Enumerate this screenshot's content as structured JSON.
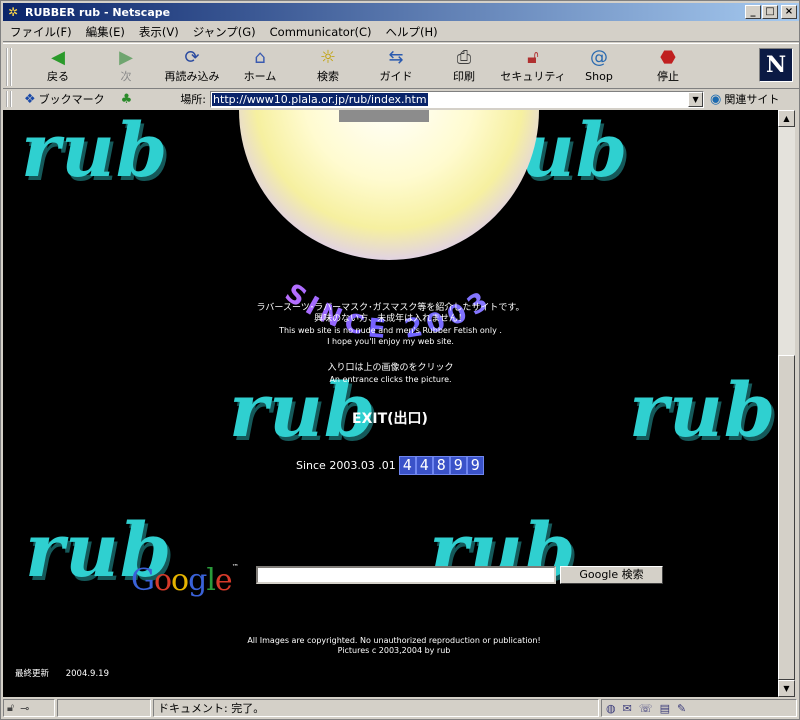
{
  "window": {
    "title": "RUBBER rub - Netscape",
    "app_icon": "netscape-icon",
    "controls": [
      "_",
      "□",
      "×"
    ]
  },
  "menu": [
    "ファイル(F)",
    "編集(E)",
    "表示(V)",
    "ジャンプ(G)",
    "Communicator(C)",
    "ヘルプ(H)"
  ],
  "toolbar": {
    "buttons": [
      {
        "label": "戻る",
        "icon": "back-arrow-icon",
        "enabled": true
      },
      {
        "label": "次",
        "icon": "forward-arrow-icon",
        "enabled": false
      },
      {
        "label": "再読み込み",
        "icon": "reload-icon",
        "enabled": true
      },
      {
        "label": "ホーム",
        "icon": "home-icon",
        "enabled": true
      },
      {
        "label": "検索",
        "icon": "search-icon",
        "enabled": true
      },
      {
        "label": "ガイド",
        "icon": "guide-icon",
        "enabled": true
      },
      {
        "label": "印刷",
        "icon": "print-icon",
        "enabled": true
      },
      {
        "label": "セキュリティ",
        "icon": "security-lock-icon",
        "enabled": true
      },
      {
        "label": "Shop",
        "icon": "shop-icon",
        "enabled": true
      },
      {
        "label": "停止",
        "icon": "stop-icon",
        "enabled": true
      }
    ],
    "logo": "N"
  },
  "location_bar": {
    "bookmarks_label": "ブックマーク",
    "location_label": "場所:",
    "url": "http://www10.plala.or.jp/rub/index.htm",
    "related_label": "関連サイト"
  },
  "page": {
    "logo_word": "rub",
    "badge_text": "SINCE 2003",
    "intro_jp_1": "ラバースーツ･ラバーマスク･ガスマスク等を紹介したサイトです。",
    "intro_jp_2": "興味のない方、未成年は入れません！",
    "intro_en_1": "This web site is no nude and men's Rubber Fetish only .",
    "intro_en_2": "I hope you'll enjoy my web site.",
    "entrance_jp": "入り口は上の画像のをクリック",
    "entrance_en": "An entrance clicks the picture.",
    "exit_label": "EXIT(出口)",
    "since_label": "Since 2003.03 .01",
    "counter_digits": [
      "4",
      "4",
      "8",
      "9",
      "9"
    ],
    "google_logo": "Google",
    "google_tm": "™",
    "google_search_button": "Google 検索",
    "google_search_value": "",
    "copyright_1": "All Images are copyrighted. No unauthorized reproduction or publication!",
    "copyright_2": "Pictures c 2003,2004 by rub",
    "updated_label": "最終更新",
    "updated_date": "2004.9.19"
  },
  "status": {
    "text": "ドキュメント: 完了。"
  },
  "colors": {
    "background": "#000000",
    "logo_teal": "#2fd0d0",
    "counter_blue": "#3a52c8",
    "titlebar": "#0a246a"
  }
}
